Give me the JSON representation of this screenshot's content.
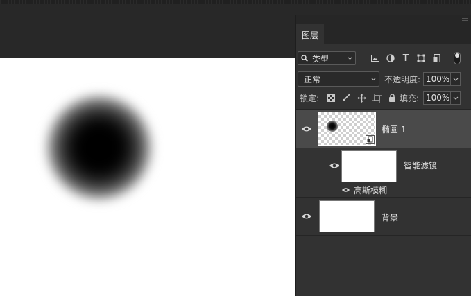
{
  "panel": {
    "tab_label": "图层",
    "filter": {
      "kind_label": "类型"
    },
    "blend": {
      "mode": "正常"
    },
    "opacity": {
      "label": "不透明度:",
      "value": "100%"
    },
    "lock": {
      "label": "锁定:"
    },
    "fill": {
      "label": "填充:",
      "value": "100%"
    }
  },
  "layers": [
    {
      "name": "椭圆 1",
      "type": "smart-object",
      "visible": true,
      "selected": true
    },
    {
      "name": "智能滤镜",
      "type": "smart-filter-group",
      "visible": true
    },
    {
      "name": "高斯模糊",
      "type": "filter",
      "visible": true
    },
    {
      "name": "背景",
      "type": "background",
      "visible": true
    }
  ],
  "icons": {
    "filter_search": "search-icon",
    "filter_pixel": "image-icon",
    "filter_adjust": "contrast-icon",
    "filter_type": "text-icon",
    "filter_shape": "transform-icon",
    "filter_smart": "smart-object-icon",
    "lock_pixels": "checkerboard-icon",
    "lock_paint": "brush-icon",
    "lock_position": "move-icon",
    "lock_artboard": "crop-icon",
    "lock_all": "lock-icon",
    "visibility": "eye-icon"
  },
  "colors": {
    "panel_bg": "#323232",
    "selected_row": "#4a4a4a",
    "canvas": "#ffffff"
  }
}
